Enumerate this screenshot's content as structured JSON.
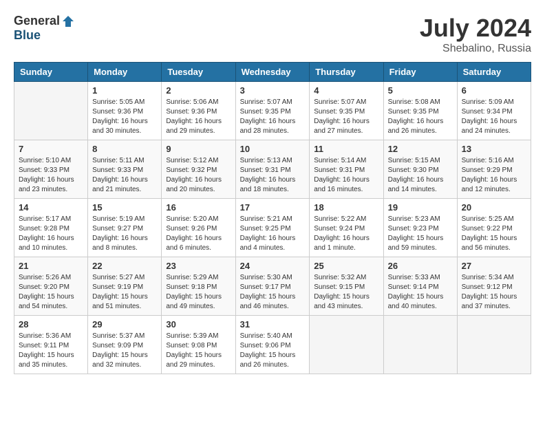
{
  "logo": {
    "general": "General",
    "blue": "Blue"
  },
  "title": {
    "month_year": "July 2024",
    "location": "Shebalino, Russia"
  },
  "headers": [
    "Sunday",
    "Monday",
    "Tuesday",
    "Wednesday",
    "Thursday",
    "Friday",
    "Saturday"
  ],
  "weeks": [
    [
      {
        "day": "",
        "info": ""
      },
      {
        "day": "1",
        "info": "Sunrise: 5:05 AM\nSunset: 9:36 PM\nDaylight: 16 hours\nand 30 minutes."
      },
      {
        "day": "2",
        "info": "Sunrise: 5:06 AM\nSunset: 9:36 PM\nDaylight: 16 hours\nand 29 minutes."
      },
      {
        "day": "3",
        "info": "Sunrise: 5:07 AM\nSunset: 9:35 PM\nDaylight: 16 hours\nand 28 minutes."
      },
      {
        "day": "4",
        "info": "Sunrise: 5:07 AM\nSunset: 9:35 PM\nDaylight: 16 hours\nand 27 minutes."
      },
      {
        "day": "5",
        "info": "Sunrise: 5:08 AM\nSunset: 9:35 PM\nDaylight: 16 hours\nand 26 minutes."
      },
      {
        "day": "6",
        "info": "Sunrise: 5:09 AM\nSunset: 9:34 PM\nDaylight: 16 hours\nand 24 minutes."
      }
    ],
    [
      {
        "day": "7",
        "info": "Sunrise: 5:10 AM\nSunset: 9:33 PM\nDaylight: 16 hours\nand 23 minutes."
      },
      {
        "day": "8",
        "info": "Sunrise: 5:11 AM\nSunset: 9:33 PM\nDaylight: 16 hours\nand 21 minutes."
      },
      {
        "day": "9",
        "info": "Sunrise: 5:12 AM\nSunset: 9:32 PM\nDaylight: 16 hours\nand 20 minutes."
      },
      {
        "day": "10",
        "info": "Sunrise: 5:13 AM\nSunset: 9:31 PM\nDaylight: 16 hours\nand 18 minutes."
      },
      {
        "day": "11",
        "info": "Sunrise: 5:14 AM\nSunset: 9:31 PM\nDaylight: 16 hours\nand 16 minutes."
      },
      {
        "day": "12",
        "info": "Sunrise: 5:15 AM\nSunset: 9:30 PM\nDaylight: 16 hours\nand 14 minutes."
      },
      {
        "day": "13",
        "info": "Sunrise: 5:16 AM\nSunset: 9:29 PM\nDaylight: 16 hours\nand 12 minutes."
      }
    ],
    [
      {
        "day": "14",
        "info": "Sunrise: 5:17 AM\nSunset: 9:28 PM\nDaylight: 16 hours\nand 10 minutes."
      },
      {
        "day": "15",
        "info": "Sunrise: 5:19 AM\nSunset: 9:27 PM\nDaylight: 16 hours\nand 8 minutes."
      },
      {
        "day": "16",
        "info": "Sunrise: 5:20 AM\nSunset: 9:26 PM\nDaylight: 16 hours\nand 6 minutes."
      },
      {
        "day": "17",
        "info": "Sunrise: 5:21 AM\nSunset: 9:25 PM\nDaylight: 16 hours\nand 4 minutes."
      },
      {
        "day": "18",
        "info": "Sunrise: 5:22 AM\nSunset: 9:24 PM\nDaylight: 16 hours\nand 1 minute."
      },
      {
        "day": "19",
        "info": "Sunrise: 5:23 AM\nSunset: 9:23 PM\nDaylight: 15 hours\nand 59 minutes."
      },
      {
        "day": "20",
        "info": "Sunrise: 5:25 AM\nSunset: 9:22 PM\nDaylight: 15 hours\nand 56 minutes."
      }
    ],
    [
      {
        "day": "21",
        "info": "Sunrise: 5:26 AM\nSunset: 9:20 PM\nDaylight: 15 hours\nand 54 minutes."
      },
      {
        "day": "22",
        "info": "Sunrise: 5:27 AM\nSunset: 9:19 PM\nDaylight: 15 hours\nand 51 minutes."
      },
      {
        "day": "23",
        "info": "Sunrise: 5:29 AM\nSunset: 9:18 PM\nDaylight: 15 hours\nand 49 minutes."
      },
      {
        "day": "24",
        "info": "Sunrise: 5:30 AM\nSunset: 9:17 PM\nDaylight: 15 hours\nand 46 minutes."
      },
      {
        "day": "25",
        "info": "Sunrise: 5:32 AM\nSunset: 9:15 PM\nDaylight: 15 hours\nand 43 minutes."
      },
      {
        "day": "26",
        "info": "Sunrise: 5:33 AM\nSunset: 9:14 PM\nDaylight: 15 hours\nand 40 minutes."
      },
      {
        "day": "27",
        "info": "Sunrise: 5:34 AM\nSunset: 9:12 PM\nDaylight: 15 hours\nand 37 minutes."
      }
    ],
    [
      {
        "day": "28",
        "info": "Sunrise: 5:36 AM\nSunset: 9:11 PM\nDaylight: 15 hours\nand 35 minutes."
      },
      {
        "day": "29",
        "info": "Sunrise: 5:37 AM\nSunset: 9:09 PM\nDaylight: 15 hours\nand 32 minutes."
      },
      {
        "day": "30",
        "info": "Sunrise: 5:39 AM\nSunset: 9:08 PM\nDaylight: 15 hours\nand 29 minutes."
      },
      {
        "day": "31",
        "info": "Sunrise: 5:40 AM\nSunset: 9:06 PM\nDaylight: 15 hours\nand 26 minutes."
      },
      {
        "day": "",
        "info": ""
      },
      {
        "day": "",
        "info": ""
      },
      {
        "day": "",
        "info": ""
      }
    ]
  ]
}
